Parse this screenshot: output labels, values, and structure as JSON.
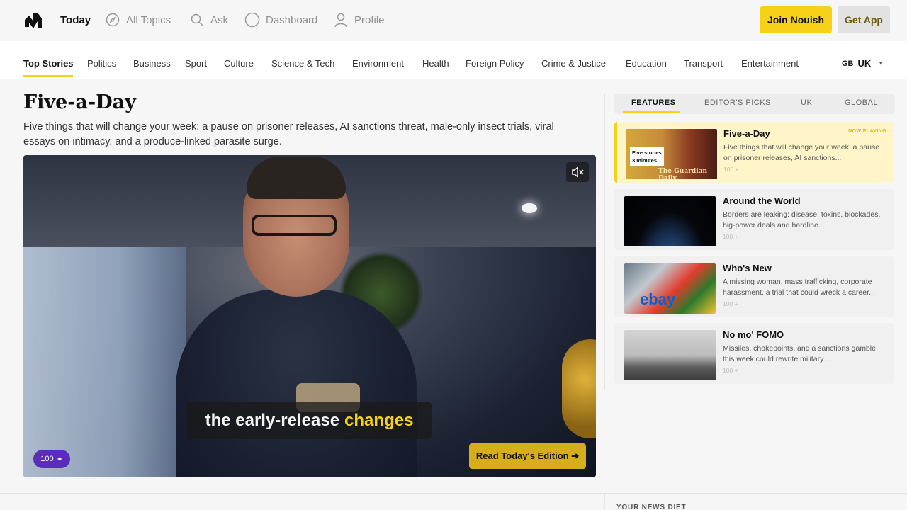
{
  "topbar": {
    "nav": [
      {
        "label": "Today",
        "icon": "none",
        "active": true
      },
      {
        "label": "All Topics",
        "icon": "compass-icon"
      },
      {
        "label": "Ask",
        "icon": "search-icon"
      },
      {
        "label": "Dashboard",
        "icon": "circle-icon"
      },
      {
        "label": "Profile",
        "icon": "user-icon"
      }
    ],
    "join_label": "Join Nouish",
    "app_label": "Get App",
    "accent_color": "#f7d117"
  },
  "categories": {
    "items": [
      "Top Stories",
      "Politics",
      "Business",
      "Sport",
      "Culture",
      "Science & Tech",
      "Environment",
      "Health",
      "Foreign Policy",
      "Crime & Justice",
      "Education",
      "Transport",
      "Entertainment"
    ],
    "active": "Top Stories",
    "region_flag": "GB",
    "region_label": "UK"
  },
  "main": {
    "title": "Five-a-Day",
    "subtitle": "Five things that will change your week: a pause on prisoner releases, AI sanctions threat, male-only insect trials, viral essays on intimacy, and a produce-linked parasite surge.",
    "video": {
      "caption_main": "the early-release",
      "caption_highlight": "changes",
      "points": "100",
      "read_label": "Read Today's Edition ➔"
    }
  },
  "sidebar": {
    "tabs": [
      "FEATURES",
      "EDITOR'S PICKS",
      "UK",
      "GLOBAL"
    ],
    "active_tab": "FEATURES",
    "now_playing_label": "NOW PLAYING",
    "cards": [
      {
        "title": "Five-a-Day",
        "desc": "Five things that will change your week: a pause on prisoner releases, AI sanctions...",
        "points": "100 +",
        "thumb_label_1": "Five stories",
        "thumb_label_2": "3 minutes",
        "thumb_brand": "The Guardian Daily"
      },
      {
        "title": "Around the World",
        "desc": "Borders are leaking: disease, toxins, blockades, big-power deals and hardline...",
        "points": "100 +"
      },
      {
        "title": "Who's New",
        "desc": "A missing woman, mass trafficking, corporate harassment, a trial that could wreck a career...",
        "points": "100 +",
        "thumb_text": "ebay"
      },
      {
        "title": "No mo' FOMO",
        "desc": "Missiles, chokepoints, and a sanctions gamble: this week could rewrite military...",
        "points": "100 +"
      }
    ]
  },
  "footer": {
    "news_diet_label": "YOUR NEWS DIET"
  }
}
